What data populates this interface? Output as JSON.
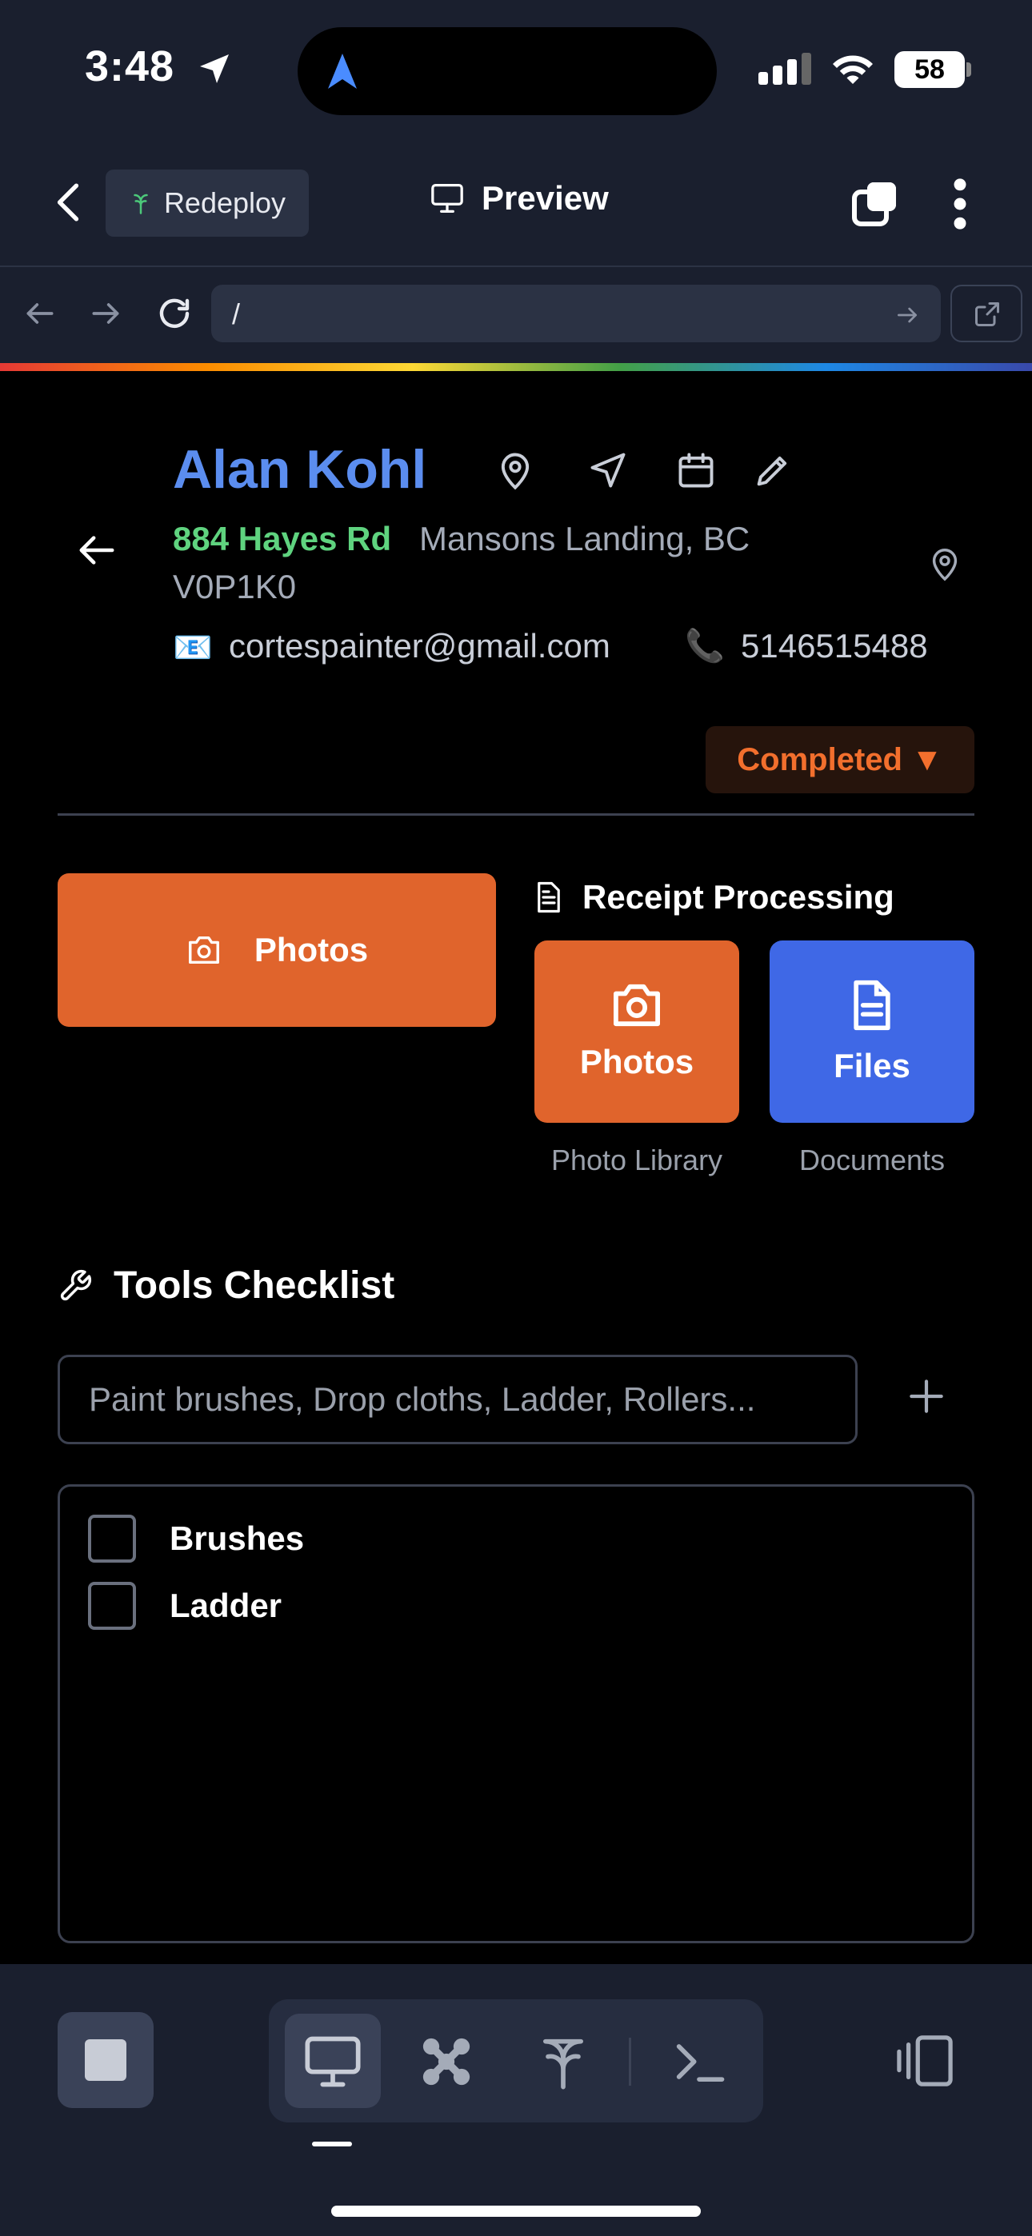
{
  "status": {
    "time": "3:48",
    "battery": "58"
  },
  "topbar": {
    "redeploy_label": "Redeploy",
    "preview_label": "Preview"
  },
  "url": {
    "path": "/"
  },
  "client": {
    "name": "Alan Kohl",
    "street": "884 Hayes Rd",
    "city": "Mansons Landing, BC",
    "postal": "V0P1K0",
    "email_icon": "📧",
    "email": "cortespainter@gmail.com",
    "phone_icon": "📞",
    "phone": "5146515488"
  },
  "status_pill": {
    "label": "Completed ▼",
    "color": "#f26f2d"
  },
  "photos": {
    "main_label": "Photos"
  },
  "receipt": {
    "title": "Receipt Processing",
    "photos_label": "Photos",
    "photos_caption": "Photo Library",
    "files_label": "Files",
    "files_caption": "Documents"
  },
  "tools": {
    "title": "Tools Checklist",
    "placeholder": "Paint brushes, Drop cloths, Ladder, Rollers...",
    "items": [
      {
        "label": "Brushes",
        "checked": false
      },
      {
        "label": "Ladder",
        "checked": false
      }
    ]
  },
  "colors": {
    "accent_orange": "#e0642c",
    "accent_blue": "#3f68e6",
    "name_blue": "#5b8def",
    "street_green": "#5fd37f"
  }
}
